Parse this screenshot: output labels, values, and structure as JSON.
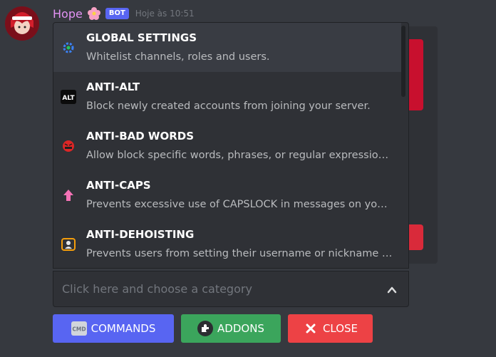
{
  "message": {
    "author": "Hope",
    "bot_badge": "BOT",
    "timestamp": "Hoje às 10:51"
  },
  "menu": {
    "options": [
      {
        "label": "GLOBAL SETTINGS",
        "description": "Whitelist channels, roles and users.",
        "icon": "gear-icon"
      },
      {
        "label": "ANTI-ALT",
        "description": "Block newly created accounts from joining your server.",
        "icon": "alt-icon"
      },
      {
        "label": "ANTI-BAD WORDS",
        "description": "Allow block specific words, phrases, or regular expressio…",
        "icon": "angry-face-icon"
      },
      {
        "label": "ANTI-CAPS",
        "description": "Prevents excessive use of CAPSLOCK in messages on yo…",
        "icon": "arrow-up-icon"
      },
      {
        "label": "ANTI-DEHOISTING",
        "description": "Prevents users from setting their username or nickname t…",
        "icon": "user-badge-icon"
      }
    ]
  },
  "select": {
    "placeholder": "Click here and choose a category"
  },
  "buttons": {
    "commands": "COMMANDS",
    "addons": "ADDONS",
    "close": "CLOSE"
  },
  "colors": {
    "background": "#36393f",
    "blurple": "#5865f2",
    "green": "#3ba55c",
    "red": "#ed4245",
    "username": "#e392f4"
  }
}
